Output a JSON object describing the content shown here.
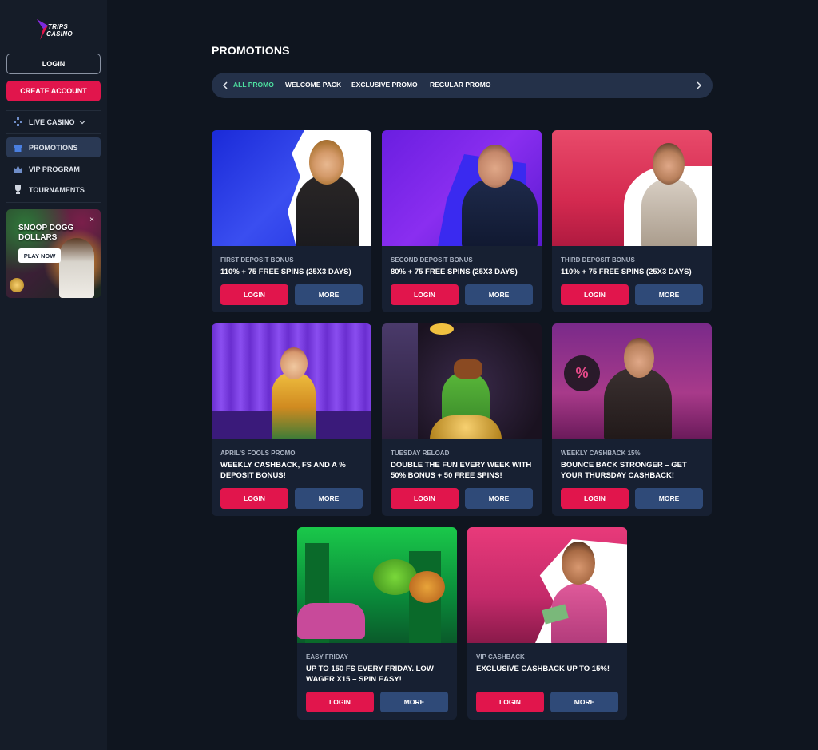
{
  "sidebar": {
    "logo_text": "TRIPS\nCASINO",
    "login_label": "LOGIN",
    "create_account_label": "CREATE ACCOUNT",
    "nav": [
      {
        "label": "LIVE CASINO",
        "icon": "dice-icon"
      },
      {
        "label": "PROMOTIONS",
        "icon": "gift-icon",
        "active": true
      },
      {
        "label": "VIP PROGRAM",
        "icon": "crown-icon"
      },
      {
        "label": "TOURNAMENTS",
        "icon": "trophy-icon"
      }
    ],
    "banner": {
      "title": "SNOOP DOGG DOLLARS",
      "play_label": "PLAY NOW",
      "close_glyph": "×"
    }
  },
  "main": {
    "title": "PROMOTIONS",
    "tabs": [
      "ALL PROMO",
      "WELCOME PACK",
      "EXCLUSIVE PROMO",
      "REGULAR PROMO"
    ],
    "active_tab": "ALL PROMO",
    "promos": [
      {
        "tag": "FIRST DEPOSIT BONUS",
        "title": "110% + 75 FREE SPINS (25X3 DAYS)",
        "login": "LOGIN",
        "more": "MORE"
      },
      {
        "tag": "SECOND DEPOSIT BONUS",
        "title": "80% + 75 FREE SPINS (25X3 DAYS)",
        "login": "LOGIN",
        "more": "MORE"
      },
      {
        "tag": "THIRD DEPOSIT BONUS",
        "title": "110% + 75 FREE SPINS (25X3 DAYS)",
        "login": "LOGIN",
        "more": "MORE"
      },
      {
        "tag": "APRIL'S FOOLS PROMO",
        "title": "WEEKLY CASHBACK, FS AND A % DEPOSIT BONUS!",
        "login": "LOGIN",
        "more": "MORE"
      },
      {
        "tag": "TUESDAY RELOAD",
        "title": "DOUBLE THE FUN EVERY WEEK WITH 50% BONUS + 50 FREE SPINS!",
        "login": "LOGIN",
        "more": "MORE"
      },
      {
        "tag": "WEEKLY CASHBACK 15%",
        "title": "BOUNCE BACK STRONGER – GET YOUR THURSDAY CASHBACK!",
        "login": "LOGIN",
        "more": "MORE"
      },
      {
        "tag": "EASY FRIDAY",
        "title": "UP TO 150 FS EVERY FRIDAY. LOW WAGER X15 – SPIN EASY!",
        "login": "LOGIN",
        "more": "MORE"
      },
      {
        "tag": "VIP CASHBACK",
        "title": "EXCLUSIVE CASHBACK UP TO 15%!",
        "login": "LOGIN",
        "more": "MORE"
      }
    ]
  },
  "colors": {
    "accent_red": "#e1154c",
    "accent_blue": "#2f4a78",
    "active_tab": "#4ee0a0",
    "background": "#0f151f",
    "sidebar": "#151c28"
  }
}
